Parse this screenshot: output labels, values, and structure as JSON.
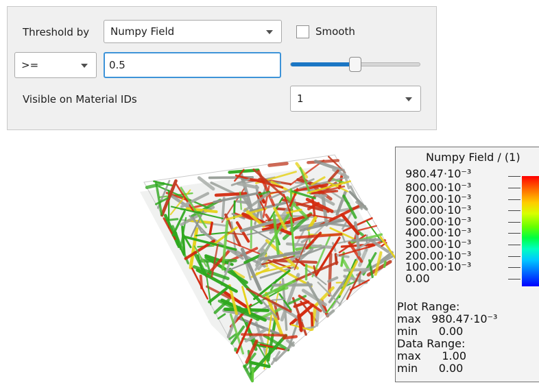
{
  "threshold": {
    "label": "Threshold by",
    "field": "Numpy Field",
    "smooth_label": "Smooth",
    "smooth_checked": false
  },
  "operator": {
    "value": ">="
  },
  "value_input": {
    "value": "0.5"
  },
  "slider": {
    "level": 0.5
  },
  "material": {
    "label": "Visible on Material IDs",
    "value": "1"
  },
  "legend": {
    "title": "Numpy Field / (1)",
    "max_label": "980.47·10⁻³",
    "tick_labels": [
      "800.00·10⁻³",
      "700.00·10⁻³",
      "600.00·10⁻³",
      "500.00·10⁻³",
      "400.00·10⁻³",
      "300.00·10⁻³",
      "200.00·10⁻³",
      "100.00·10⁻³",
      "0.00"
    ],
    "plot_range_label": "Plot Range:",
    "plot_max": "max   980.47·10⁻³",
    "plot_min": "min      0.00",
    "data_range_label": "Data Range:",
    "data_max": "max      1.00",
    "data_min": "min      0.00"
  },
  "colors": {
    "accent": "#1b76c4",
    "focus": "#3d93d8",
    "fiber_red": "#d42a0e",
    "fiber_gray": "#9aa09a",
    "fiber_green": "#2ea81e"
  }
}
